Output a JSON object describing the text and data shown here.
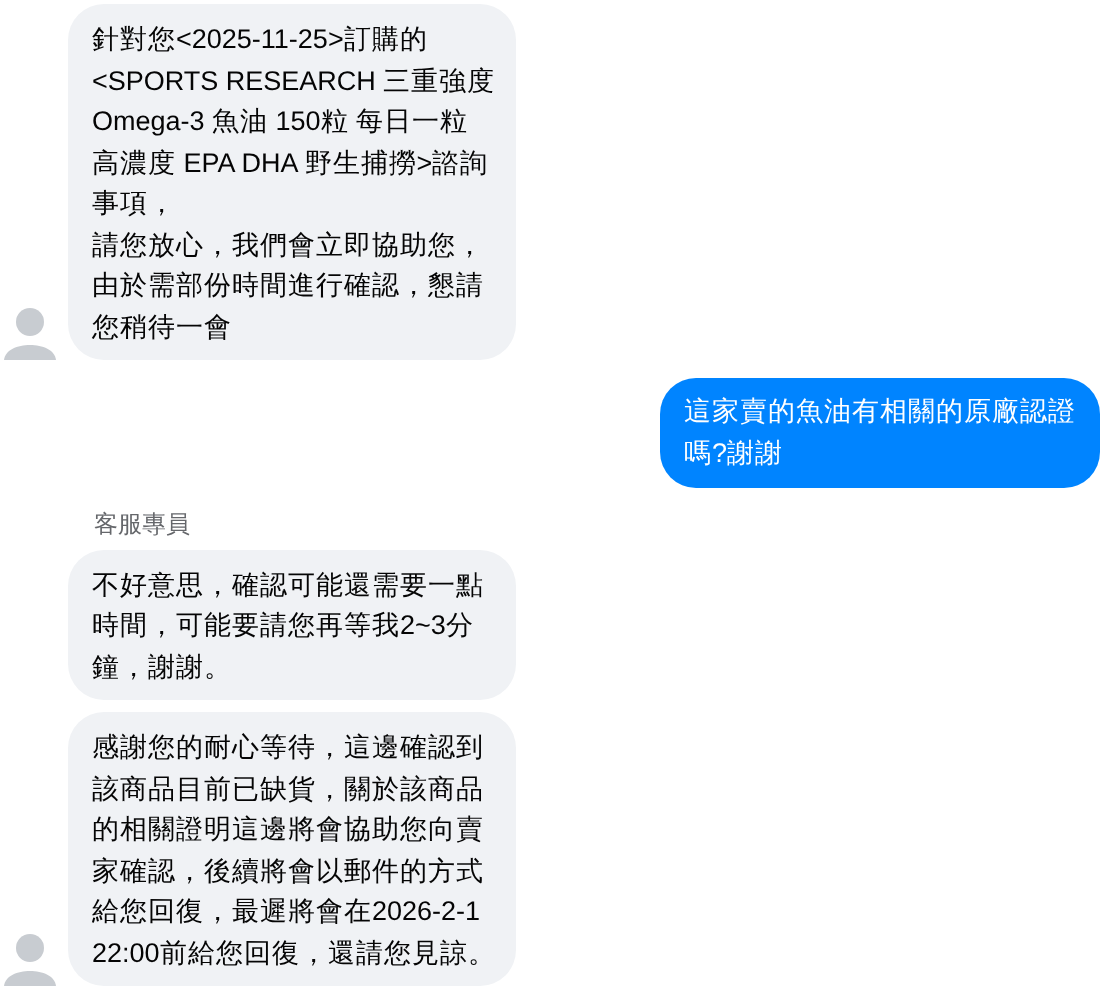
{
  "messages": [
    {
      "kind": "received",
      "avatar": true,
      "paragraphs": [
        "針對您<2025-11-25>訂購的<SPORTS RESEARCH 三重強度 Omega-3 魚油 150粒 每日一粒高濃度 EPA DHA 野生捕撈>諮詢事項，",
        "請您放心，我們會立即協助您，由於需部份時間進行確認，懇請您稍待一會"
      ]
    },
    {
      "kind": "sent",
      "paragraphs": [
        "這家賣的魚油有相關的原廠認證嗎?謝謝"
      ]
    },
    {
      "kind": "sender",
      "paragraphs": [
        "客服專員"
      ]
    },
    {
      "kind": "received",
      "avatar": false,
      "paragraphs": [
        "不好意思，確認可能還需要一點時間，可能要請您再等我2~3分鐘，謝謝。"
      ]
    },
    {
      "kind": "received",
      "avatar": true,
      "paragraphs": [
        "感謝您的耐心等待，這邊確認到該商品目前已缺貨，關於該商品的相關證明這邊將會協助您向賣家確認，後續將會以郵件的方式給您回復，最遲將會在2026-2-1 22:00前給您回復，還請您見諒。"
      ]
    }
  ]
}
